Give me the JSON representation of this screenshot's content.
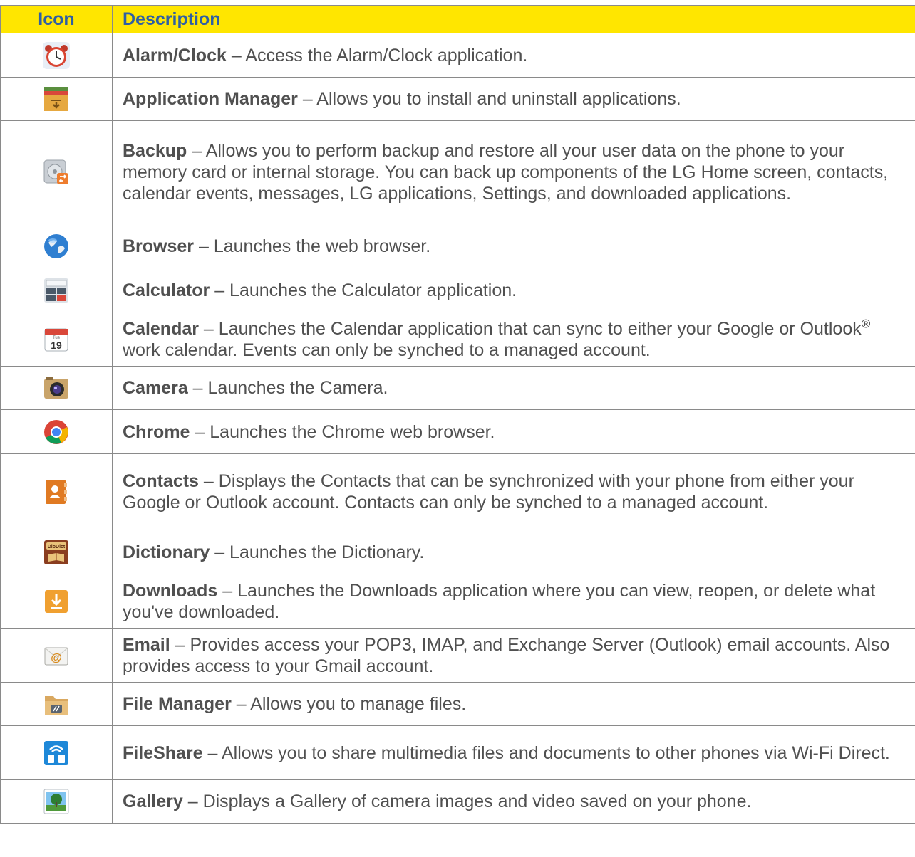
{
  "header": {
    "icon": "Icon",
    "description": "Description"
  },
  "rows": [
    {
      "icon": "alarm-clock-icon",
      "name": "Alarm/Clock",
      "desc": " – Access the Alarm/Clock application."
    },
    {
      "icon": "application-manager-icon",
      "name": "Application Manager",
      "desc": " – Allows you to install and uninstall applications."
    },
    {
      "icon": "backup-icon",
      "name": "Backup",
      "desc": " – Allows you to perform backup and restore all your user data on the phone to your memory card or internal storage. You can back up components of the LG Home screen, contacts, calendar events, messages, LG applications, Settings, and downloaded applications."
    },
    {
      "icon": "browser-icon",
      "name": "Browser",
      "desc": " – Launches the web browser."
    },
    {
      "icon": "calculator-icon",
      "name": "Calculator",
      "desc": " – Launches the Calculator application."
    },
    {
      "icon": "calendar-icon",
      "name": "Calendar",
      "desc": " – Launches the Calendar application that can sync to either your Google or Outlook",
      "sup": "®",
      "desc_after": " work calendar. Events can only be synched to a managed account."
    },
    {
      "icon": "camera-icon",
      "name": "Camera",
      "desc": " – Launches the Camera."
    },
    {
      "icon": "chrome-icon",
      "name": "Chrome",
      "desc": " – Launches the Chrome web browser."
    },
    {
      "icon": "contacts-icon",
      "name": "Contacts",
      "desc": " – Displays the Contacts that can be synchronized with your phone from either your Google or Outlook account. Contacts can only be synched to a managed account."
    },
    {
      "icon": "dictionary-icon",
      "name": "Dictionary",
      "desc": " – Launches the Dictionary."
    },
    {
      "icon": "downloads-icon",
      "name": "Downloads",
      "desc": " – Launches the Downloads application where you can view, reopen, or delete what you've downloaded."
    },
    {
      "icon": "email-icon",
      "name": "Email",
      "desc": " – Provides access your POP3, IMAP, and Exchange Server (Outlook) email accounts. Also provides access to your Gmail account."
    },
    {
      "icon": "file-manager-icon",
      "name": "File Manager",
      "desc": " – Allows you to manage files."
    },
    {
      "icon": "fileshare-icon",
      "name": "FileShare",
      "desc": " – Allows you to share multimedia files and documents to other phones via Wi-Fi Direct."
    },
    {
      "icon": "gallery-icon",
      "name": "Gallery",
      "desc": " – Displays a Gallery of camera images and video saved on your phone."
    }
  ],
  "icon_text": {
    "calendar_day": "Tue",
    "calendar_date": "19",
    "dictionary_label": "DioDict"
  }
}
